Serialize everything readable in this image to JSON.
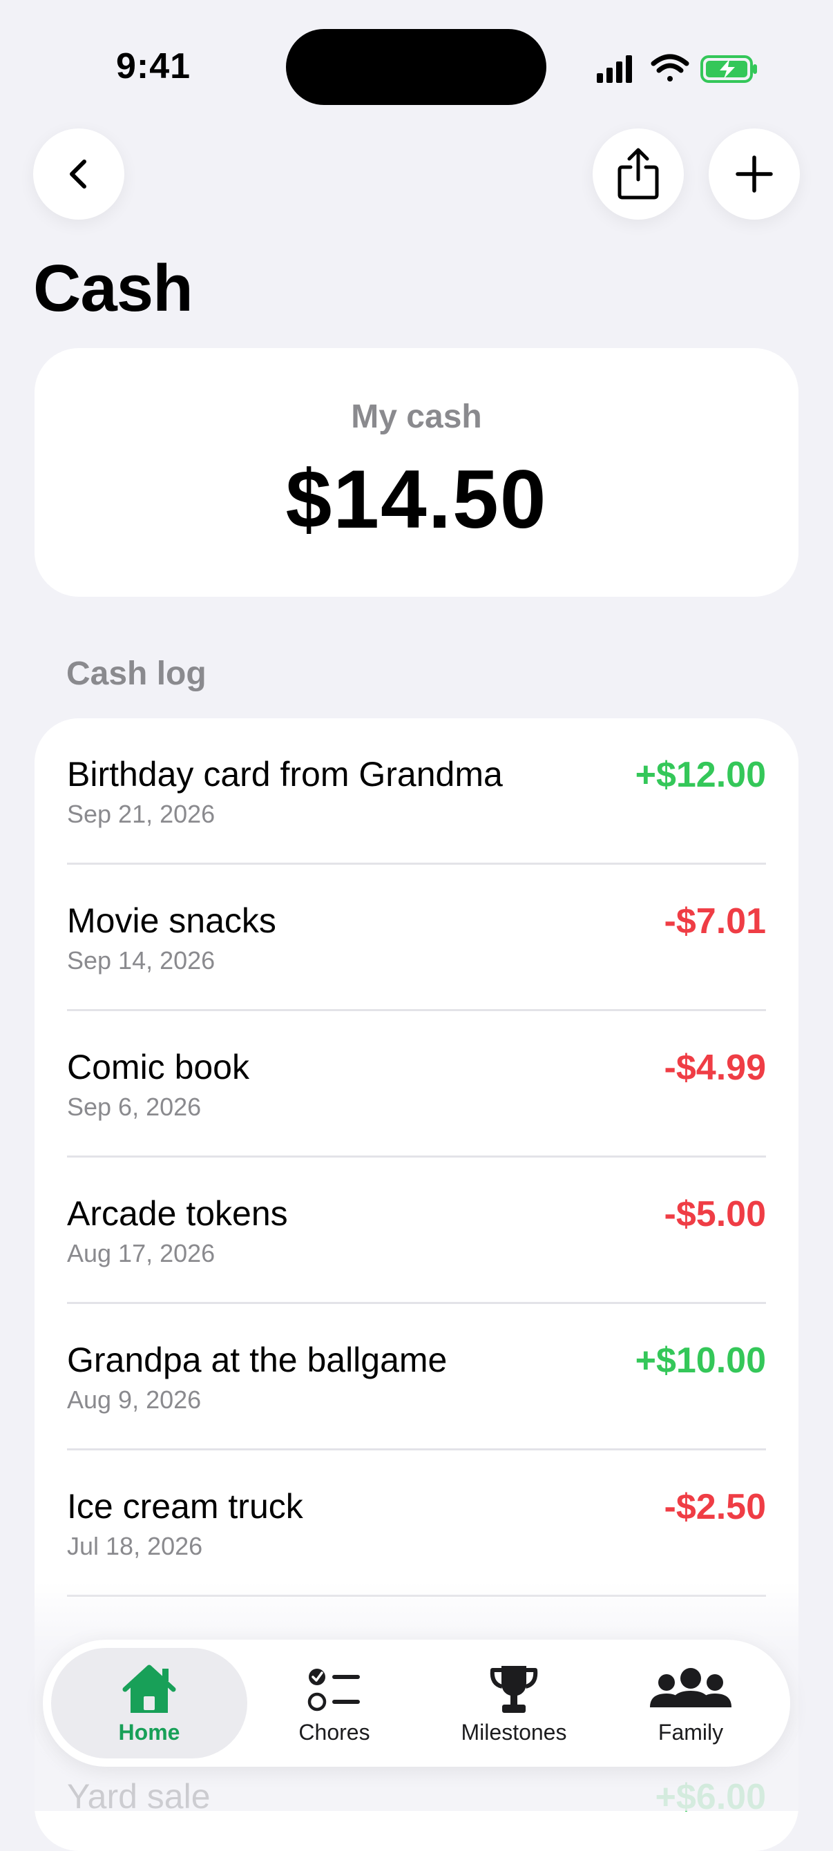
{
  "status_bar": {
    "time": "9:41"
  },
  "header": {
    "back_icon": "chevron-left-icon",
    "share_icon": "share-icon",
    "add_icon": "plus-icon",
    "title": "Cash"
  },
  "balance": {
    "label": "My cash",
    "value": "$14.50"
  },
  "log": {
    "section_label": "Cash log",
    "entries": [
      {
        "title": "Birthday card from Grandma",
        "date": "Sep 21, 2026",
        "amount": "+$12.00",
        "type": "credit"
      },
      {
        "title": "Movie snacks",
        "date": "Sep 14, 2026",
        "amount": "-$7.01",
        "type": "debit"
      },
      {
        "title": "Comic book",
        "date": "Sep 6, 2026",
        "amount": "-$4.99",
        "type": "debit"
      },
      {
        "title": "Arcade tokens",
        "date": "Aug 17, 2026",
        "amount": "-$5.00",
        "type": "debit"
      },
      {
        "title": "Grandpa at the ballgame",
        "date": "Aug 9, 2026",
        "amount": "+$10.00",
        "type": "credit"
      },
      {
        "title": "Ice cream truck",
        "date": "Jul 18, 2026",
        "amount": "-$2.50",
        "type": "debit"
      },
      {
        "title": "Yard sale",
        "date": "",
        "amount": "+$6.00",
        "type": "credit"
      }
    ]
  },
  "tab_bar": {
    "tabs": [
      {
        "label": "Home",
        "icon": "home-icon",
        "active": true
      },
      {
        "label": "Chores",
        "icon": "checklist-icon",
        "active": false
      },
      {
        "label": "Milestones",
        "icon": "trophy-icon",
        "active": false
      },
      {
        "label": "Family",
        "icon": "people-icon",
        "active": false
      }
    ]
  },
  "colors": {
    "background": "#F2F2F7",
    "credit": "#34C759",
    "debit": "#EF3D45",
    "active_tab": "#18A058"
  }
}
